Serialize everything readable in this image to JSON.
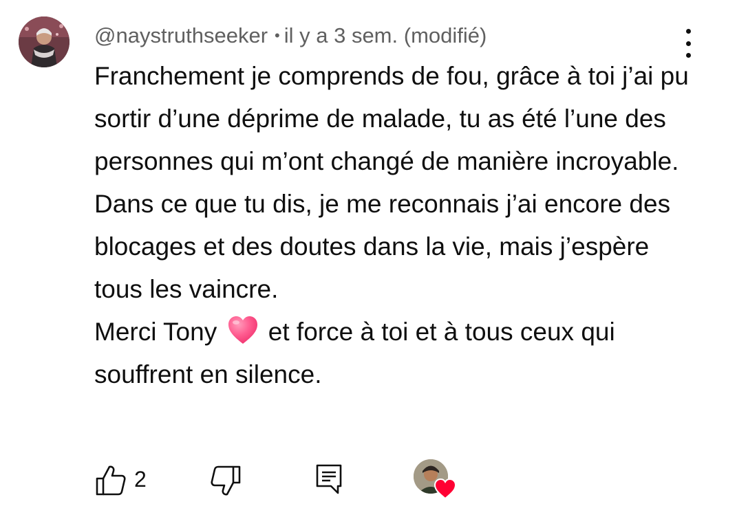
{
  "comment": {
    "author": "@naystruthseeker",
    "separator": "•",
    "time": "il y a 3 sem.",
    "edited": "(modifié)",
    "body_main": "Franchement je comprends de fou, grâce à toi j’ai pu sortir d’une déprime de malade, tu as été l’une des personnes qui m’ont changé de manière incroyable. Dans ce que tu dis, je me reconnais j’ai encore des blocages et des doutes dans la vie, mais j’espère tous les vaincre.",
    "body_thanks_before": "Merci Tony",
    "body_thanks_after": "et force à toi et à tous ceux qui souffrent en silence.",
    "emoji": "pink-heart"
  },
  "actions": {
    "like_count": "2",
    "icons": {
      "like": "thumb-up-icon",
      "dislike": "thumb-down-icon",
      "reply": "reply-comment-icon",
      "more": "more-vertical-icon",
      "creator_heart": "heart-icon"
    }
  },
  "colors": {
    "text": "#0f0f0f",
    "meta": "#606060",
    "heart_red": "#ff0033",
    "emoji_pink": "#ff4f8b"
  }
}
